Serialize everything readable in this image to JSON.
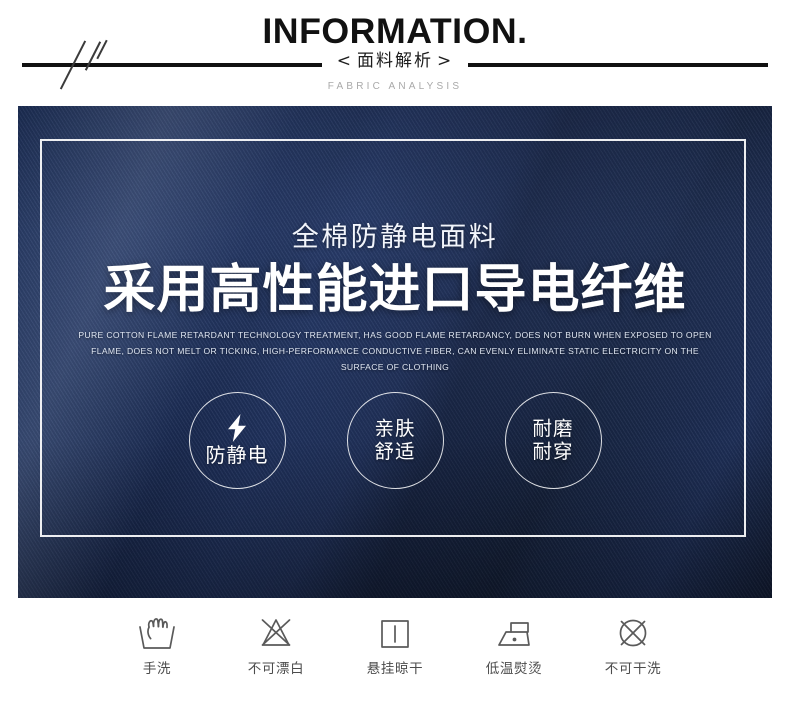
{
  "header": {
    "title": "INFORMATION.",
    "bracket_open": "<",
    "bracket_close": ">",
    "chinese_subtitle": "面料解析",
    "english_subtitle": "FABRIC ANALYSIS"
  },
  "banner": {
    "sub_title": "全棉防静电面料",
    "main_title": "采用高性能进口导电纤维",
    "description": "PURE COTTON FLAME RETARDANT TECHNOLOGY TREATMENT, HAS GOOD FLAME RETARDANCY, DOES NOT BURN WHEN EXPOSED TO OPEN FLAME, DOES NOT MELT OR TICKING, HIGH-PERFORMANCE CONDUCTIVE FIBER, CAN EVENLY ELIMINATE STATIC ELECTRICITY ON THE SURFACE OF CLOTHING",
    "features": [
      {
        "icon": "lightning-bolt-icon",
        "label_line1": "防静电",
        "label_line2": ""
      },
      {
        "icon": "none",
        "label_line1": "亲肤",
        "label_line2": "舒适"
      },
      {
        "icon": "none",
        "label_line1": "耐磨",
        "label_line2": "耐穿"
      }
    ]
  },
  "care_instructions": [
    {
      "icon": "hand-wash-icon",
      "label": "手洗"
    },
    {
      "icon": "no-bleach-icon",
      "label": "不可漂白"
    },
    {
      "icon": "hang-dry-icon",
      "label": "悬挂晾干"
    },
    {
      "icon": "low-iron-icon",
      "label": "低温熨烫"
    },
    {
      "icon": "no-dry-clean-icon",
      "label": "不可干洗"
    }
  ],
  "colors": {
    "banner_blue": "#1e2f57",
    "banner_blue_light": "#25396a",
    "header_text": "#111111",
    "muted_text": "#a9a9a9",
    "care_text": "#4c4c4c",
    "white": "#ffffff"
  }
}
